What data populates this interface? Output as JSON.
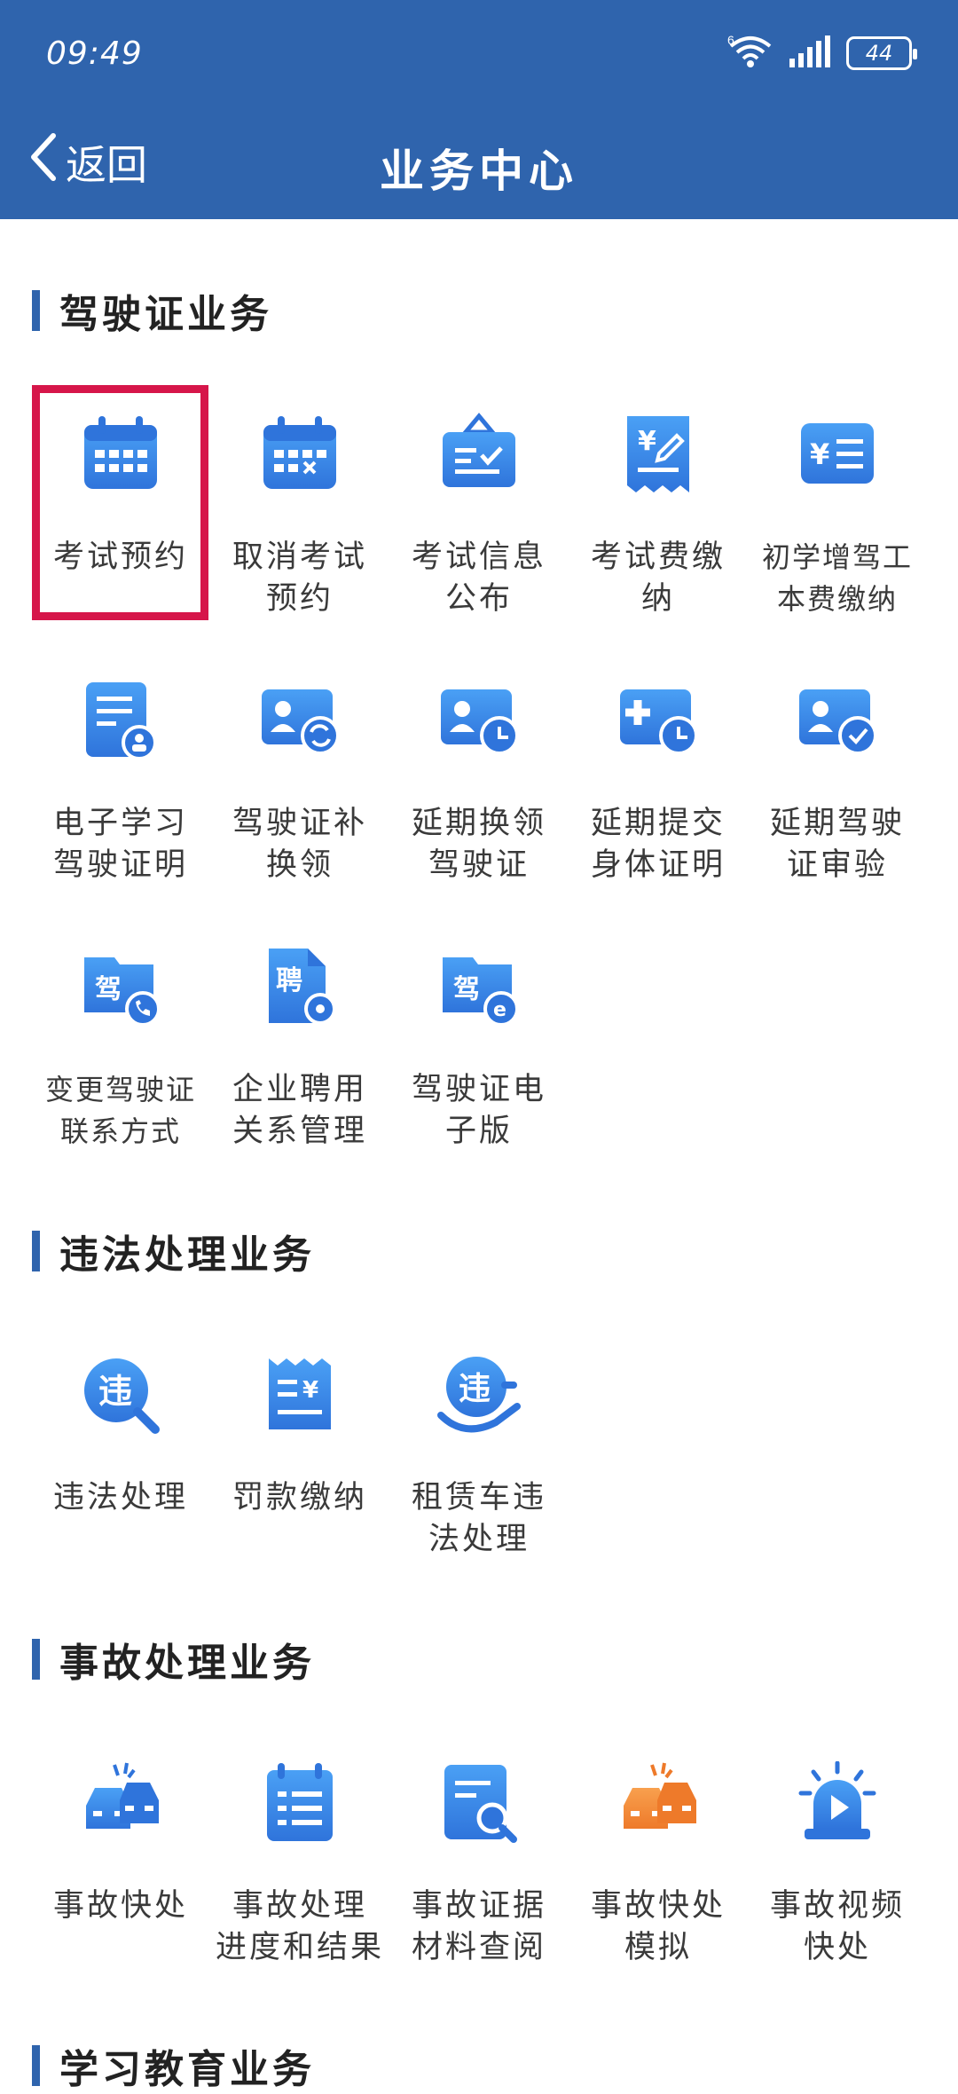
{
  "status_bar": {
    "time": "09:49",
    "network": "6",
    "battery": "44"
  },
  "nav": {
    "back_label": "返回",
    "title": "业务中心"
  },
  "sections": [
    {
      "title": "驾驶证业务",
      "items": [
        {
          "label": "考试预约",
          "icon": "calendar-icon"
        },
        {
          "label": "取消考试预约",
          "icon": "calendar-cancel-icon"
        },
        {
          "label": "考试信息公布",
          "icon": "notice-board-icon"
        },
        {
          "label": "考试费缴纳",
          "icon": "fee-receipt-icon"
        },
        {
          "label": "初学增驾工本费缴纳",
          "icon": "fee-card-icon"
        },
        {
          "label": "电子学习驾驶证明",
          "icon": "document-user-icon"
        },
        {
          "label": "驾驶证补换领",
          "icon": "id-card-exchange-icon"
        },
        {
          "label": "延期换领驾驶证",
          "icon": "id-card-clock-icon"
        },
        {
          "label": "延期提交身体证明",
          "icon": "medical-card-clock-icon"
        },
        {
          "label": "延期驾驶证审验",
          "icon": "id-card-check-icon"
        },
        {
          "label": "变更驾驶证联系方式",
          "icon": "license-phone-icon"
        },
        {
          "label": "企业聘用关系管理",
          "icon": "employment-gear-icon"
        },
        {
          "label": "驾驶证电子版",
          "icon": "license-electronic-icon"
        }
      ]
    },
    {
      "title": "违法处理业务",
      "items": [
        {
          "label": "违法处理",
          "icon": "violation-search-icon"
        },
        {
          "label": "罚款缴纳",
          "icon": "fine-receipt-icon"
        },
        {
          "label": "租赁车违法处理",
          "icon": "rental-violation-icon"
        }
      ]
    },
    {
      "title": "事故处理业务",
      "items": [
        {
          "label": "事故快处",
          "icon": "car-crash-icon"
        },
        {
          "label": "事故处理进度和结果",
          "icon": "progress-clipboard-icon"
        },
        {
          "label": "事故证据材料查阅",
          "icon": "evidence-search-icon"
        },
        {
          "label": "事故快处模拟",
          "icon": "car-crash-orange-icon"
        },
        {
          "label": "事故视频快处",
          "icon": "video-siren-icon"
        }
      ]
    },
    {
      "title": "学习教育业务",
      "items": []
    }
  ],
  "colors": {
    "header": "#2f64ad",
    "icon_blue": "#3a86e8",
    "icon_orange": "#f28a3a",
    "highlight": "#d6164a"
  }
}
